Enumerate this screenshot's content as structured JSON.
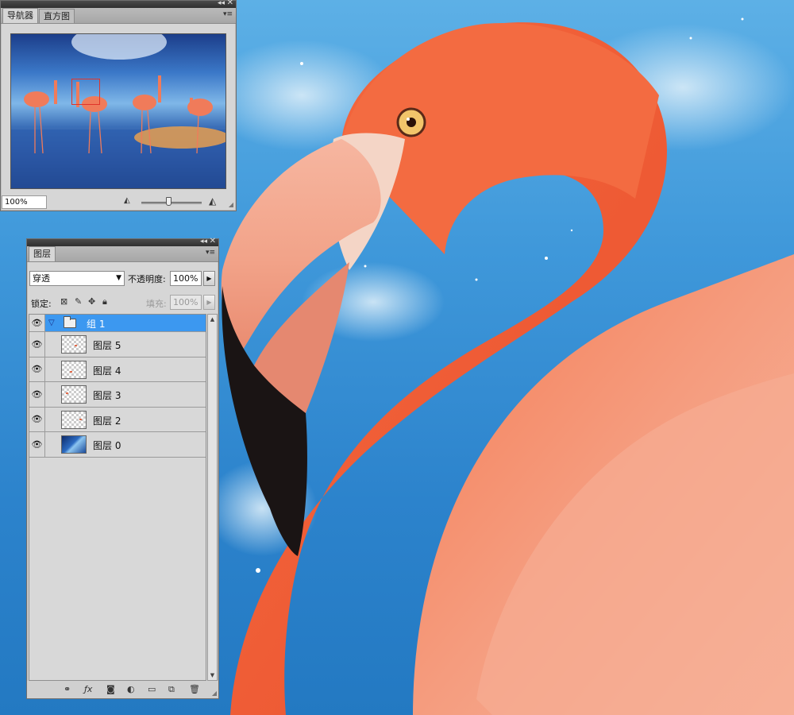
{
  "navigator": {
    "tabs": [
      {
        "label": "导航器",
        "active": true
      },
      {
        "label": "直方图",
        "active": false
      }
    ],
    "zoom_value": "100%",
    "zoom_slider_fraction": 0.45
  },
  "layers_panel": {
    "tab_label": "图层",
    "blend_mode": "穿透",
    "opacity_label": "不透明度:",
    "opacity_value": "100%",
    "lock_label": "锁定:",
    "fill_label": "填充:",
    "fill_value": "100%",
    "layers": [
      {
        "name": "组 1",
        "kind": "group",
        "visible": true,
        "selected": true,
        "expanded": true
      },
      {
        "name": "图层 5",
        "kind": "layer",
        "visible": true
      },
      {
        "name": "图层 4",
        "kind": "layer",
        "visible": true
      },
      {
        "name": "图层 3",
        "kind": "layer",
        "visible": true
      },
      {
        "name": "图层 2",
        "kind": "layer",
        "visible": true
      },
      {
        "name": "图层 0",
        "kind": "photo",
        "visible": true
      }
    ],
    "footer_icons": [
      "link-layers-icon",
      "fx-icon",
      "add-mask-icon",
      "adjustment-layer-icon",
      "new-group-icon",
      "new-layer-icon",
      "delete-layer-icon"
    ]
  },
  "colors": {
    "selection_blue": "#3c98f0",
    "panel_gray": "#d6d6d6",
    "flamingo": "#f0613a",
    "sky": "#3f98da"
  }
}
